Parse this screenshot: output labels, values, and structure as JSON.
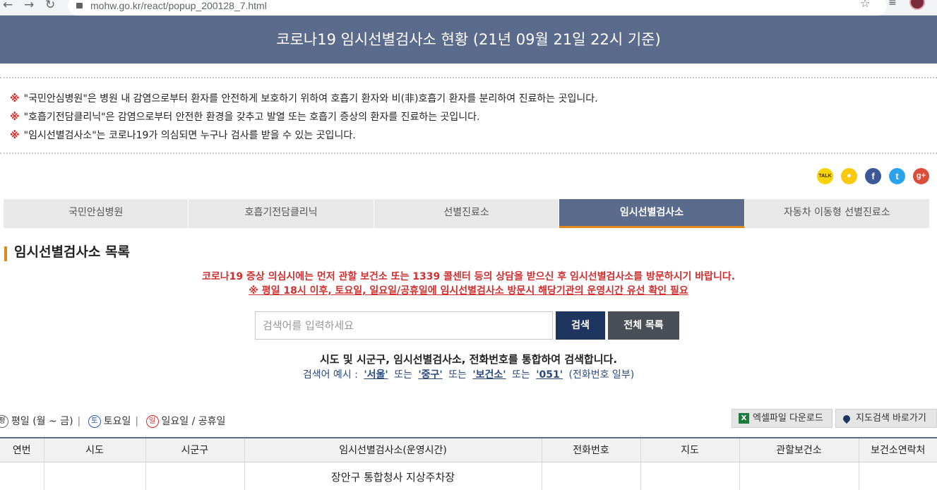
{
  "browser": {
    "url": "mohw.go.kr/react/popup_200128_7.html",
    "back": "←",
    "forward": "→",
    "reload": "↻"
  },
  "banner": {
    "title": "코로나19 임시선별검사소 현황 (21년 09월 21일 22시 기준)"
  },
  "notices": [
    "\"국민안심병원\"은 병원 내 감염으로부터 환자를 안전하게 보호하기 위하여 호흡기 환자와 비(非)호흡기 환자를 분리하여 진료하는 곳입니다.",
    "\"호흡기전담클리닉\"은 감염으로부터 안전한 환경을 갖추고 발열 또는 호흡기 증상의 환자를 진료하는 곳입니다.",
    "\"임시선별검사소\"는 코로나19가 의심되면 누구나 검사를 받을 수 있는 곳입니다."
  ],
  "notice_mark": "※",
  "social": [
    {
      "icon": "kakaotalk-icon",
      "glyph": "TALK",
      "color": "#f7d400"
    },
    {
      "icon": "kakaostory-icon",
      "glyph": "●",
      "color": "#f9c90e"
    },
    {
      "icon": "facebook-icon",
      "glyph": "f",
      "color": "#3b5998"
    },
    {
      "icon": "twitter-icon",
      "glyph": "t",
      "color": "#2aa3ef"
    },
    {
      "icon": "googleplus-icon",
      "glyph": "g+",
      "color": "#dd4b39"
    }
  ],
  "tabs": [
    "국민안심병원",
    "호흡기전담클리닉",
    "선별진료소",
    "임시선별검사소",
    "자동차 이동형 선별진료소"
  ],
  "active_tab": 3,
  "section_title": "임시선별검사소 목록",
  "warning_line1": "코로나19 증상 의심시에는 먼저 관할 보건소 또는 1339 콜센터 등의 상담을 받으신 후 임시선별검사소를 방문하시기 바랍니다.",
  "warning_line2": "※ 평일 18시 이후, 토요일, 일요일/공휴일에 임시선별검사소 방문시 해당기관의 운영시간 유선 확인 필요",
  "search": {
    "placeholder": "검색어를 입력하세요",
    "search_label": "검색",
    "all_label": "전체 목록",
    "description": "시도 및 시군구, 임시선별검사소, 전화번호를 통합하여 검색합니다.",
    "example_prefix": "검색어 예시 :",
    "examples": [
      "'서울'",
      "'중구'",
      "'보건소'",
      "'051'"
    ],
    "or_word": "또는",
    "example_suffix": "(전화번호 일부)"
  },
  "legend": {
    "weekday_icon": "평",
    "weekday": "평일 (월 ~ 금)",
    "saturday_icon": "토",
    "saturday": "토요일",
    "sunday_icon": "일",
    "sunday": "일요일 / 공휴일",
    "separator": "|"
  },
  "buttons": {
    "excel": "엑셀파일 다운로드",
    "excel_icon_glyph": "X",
    "map": "지도검색 바로가기"
  },
  "table": {
    "headers": [
      "연번",
      "시도",
      "시군구",
      "임시선별검사소(운영시간)",
      "전화번호",
      "지도",
      "관할보건소",
      "보건소연락처"
    ],
    "first_row_site": "장안구 통합청사 지상주차장"
  }
}
